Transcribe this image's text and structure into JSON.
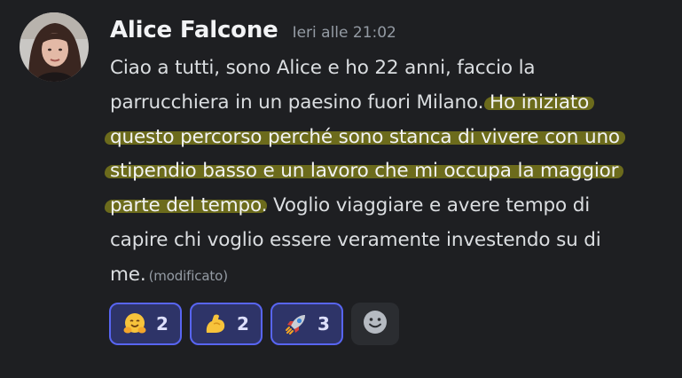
{
  "message": {
    "author": "Alice Falcone",
    "timestamp": "Ieri alle 21:02",
    "lines": [
      [
        "Ciao a tutti, sono Alice e ho 22 anni, faccio la"
      ],
      [
        "parrucchiera in un paesino fuori Milano. ",
        "Ho iniziato"
      ],
      [
        "questo percorso perché sono stanca di vivere con uno"
      ],
      [
        "stipendio basso e un lavoro che mi occupa la maggior"
      ],
      [
        "parte del tempo",
        ". Voglio viaggiare e avere tempo di"
      ],
      [
        "capire chi voglio essere veramente investendo su di"
      ],
      [
        "me."
      ]
    ],
    "edited_label": "(modificato)",
    "highlight_color": "#6f6e1c"
  },
  "reactions": [
    {
      "emoji": "hugging-face",
      "count": "2"
    },
    {
      "emoji": "flexed-biceps",
      "count": "2"
    },
    {
      "emoji": "rocket",
      "count": "3"
    }
  ],
  "add_reaction": {
    "icon": "smiley-add-icon"
  },
  "colors": {
    "background": "#1e1f22",
    "accent": "#5865f2",
    "reaction_bg": "#2e3468"
  }
}
